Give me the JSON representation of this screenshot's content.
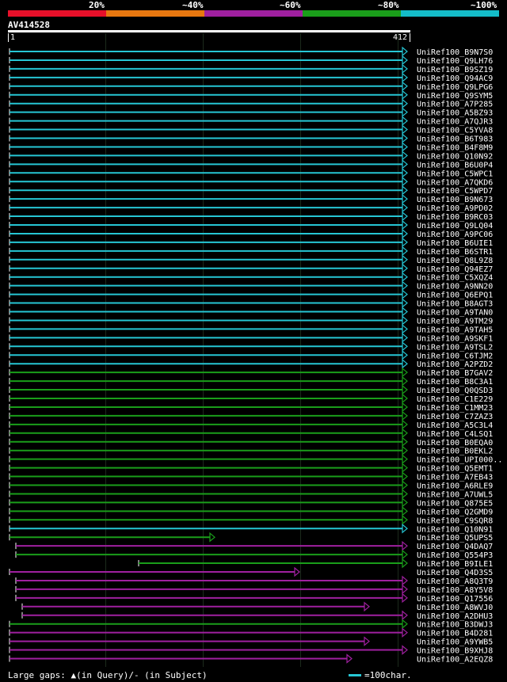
{
  "header": {
    "percent_labels": [
      "20%",
      "~40%",
      "~60%",
      "~80%",
      "~100%"
    ],
    "colors": [
      "#e8102a",
      "#e87810",
      "#a020a0",
      "#1a9e1a",
      "#14bcc8"
    ]
  },
  "query": {
    "name": "AV414528",
    "start": "1",
    "end": "412"
  },
  "hits": [
    {
      "label": "UniRef100_B9N7S0",
      "color": "#26c6d4"
    },
    {
      "label": "UniRef100_Q9LH76",
      "color": "#26c6d4"
    },
    {
      "label": "UniRef100_B9SZ19",
      "color": "#26c6d4"
    },
    {
      "label": "UniRef100_Q94AC9",
      "color": "#26c6d4"
    },
    {
      "label": "UniRef100_Q9LPG6",
      "color": "#26c6d4"
    },
    {
      "label": "UniRef100_Q9SYM5",
      "color": "#26c6d4"
    },
    {
      "label": "UniRef100_A7P285",
      "color": "#26c6d4"
    },
    {
      "label": "UniRef100_A5BZ93",
      "color": "#26c6d4"
    },
    {
      "label": "UniRef100_A7QJR3",
      "color": "#26c6d4"
    },
    {
      "label": "UniRef100_C5YVA8",
      "color": "#26c6d4"
    },
    {
      "label": "UniRef100_B6T983",
      "color": "#26c6d4"
    },
    {
      "label": "UniRef100_B4F8M9",
      "color": "#26c6d4"
    },
    {
      "label": "UniRef100_Q10N92",
      "color": "#26c6d4"
    },
    {
      "label": "UniRef100_B6U0P4",
      "color": "#26c6d4"
    },
    {
      "label": "UniRef100_C5WPC1",
      "color": "#26c6d4"
    },
    {
      "label": "UniRef100_A7QKD6",
      "color": "#26c6d4"
    },
    {
      "label": "UniRef100_C5WPD7",
      "color": "#26c6d4"
    },
    {
      "label": "UniRef100_B9N673",
      "color": "#26c6d4"
    },
    {
      "label": "UniRef100_A9PD02",
      "color": "#26c6d4"
    },
    {
      "label": "UniRef100_B9RC03",
      "color": "#26c6d4"
    },
    {
      "label": "UniRef100_Q9LQ04",
      "color": "#26c6d4"
    },
    {
      "label": "UniRef100_A9PC06",
      "color": "#26c6d4"
    },
    {
      "label": "UniRef100_B6UIE1",
      "color": "#26c6d4"
    },
    {
      "label": "UniRef100_B6STR1",
      "color": "#26c6d4"
    },
    {
      "label": "UniRef100_Q8L9Z8",
      "color": "#26c6d4"
    },
    {
      "label": "UniRef100_Q94EZ7",
      "color": "#26c6d4"
    },
    {
      "label": "UniRef100_C5XQZ4",
      "color": "#26c6d4"
    },
    {
      "label": "UniRef100_A9NN20",
      "color": "#26c6d4"
    },
    {
      "label": "UniRef100_Q6EPQ1",
      "color": "#26c6d4"
    },
    {
      "label": "UniRef100_B8AGT3",
      "color": "#26c6d4"
    },
    {
      "label": "UniRef100_A9TAN0",
      "color": "#26c6d4"
    },
    {
      "label": "UniRef100_A9TM29",
      "color": "#26c6d4"
    },
    {
      "label": "UniRef100_A9TAH5",
      "color": "#26c6d4"
    },
    {
      "label": "UniRef100_A9SKF1",
      "color": "#26c6d4"
    },
    {
      "label": "UniRef100_A9TSL2",
      "color": "#26c6d4"
    },
    {
      "label": "UniRef100_C6TJM2",
      "color": "#26c6d4"
    },
    {
      "label": "UniRef100_A2PZD2",
      "color": "#26c6d4"
    },
    {
      "label": "UniRef100_B7GAV2",
      "color": "#1a9e1a"
    },
    {
      "label": "UniRef100_B8C3A1",
      "color": "#1a9e1a"
    },
    {
      "label": "UniRef100_Q0QSD3",
      "color": "#1a9e1a"
    },
    {
      "label": "UniRef100_C1E229",
      "color": "#1a9e1a"
    },
    {
      "label": "UniRef100_C1MM23",
      "color": "#1a9e1a"
    },
    {
      "label": "UniRef100_C7ZAZ3",
      "color": "#1a9e1a"
    },
    {
      "label": "UniRef100_A5C3L4",
      "color": "#1a9e1a"
    },
    {
      "label": "UniRef100_C4LSQ1",
      "color": "#1a9e1a"
    },
    {
      "label": "UniRef100_B0EQA0",
      "color": "#1a9e1a"
    },
    {
      "label": "UniRef100_B0EKL2",
      "color": "#1a9e1a"
    },
    {
      "label": "UniRef100_UPI000..",
      "color": "#1a9e1a"
    },
    {
      "label": "UniRef100_Q5EMT1",
      "color": "#1a9e1a"
    },
    {
      "label": "UniRef100_A7EB43",
      "color": "#1a9e1a"
    },
    {
      "label": "UniRef100_A6RLE9",
      "color": "#1a9e1a"
    },
    {
      "label": "UniRef100_A7UWL5",
      "color": "#1a9e1a"
    },
    {
      "label": "UniRef100_Q875E5",
      "color": "#1a9e1a"
    },
    {
      "label": "UniRef100_Q2GMD9",
      "color": "#1a9e1a"
    },
    {
      "label": "UniRef100_C9SQR8",
      "color": "#1a9e1a"
    },
    {
      "label": "UniRef100_Q10N91",
      "color": "#26c6d4"
    },
    {
      "label": "UniRef100_Q5UPS5",
      "color": "#1a9e1a"
    },
    {
      "label": "UniRef100_Q4DAQ7",
      "color": "#a020a0"
    },
    {
      "label": "UniRef100_Q554P3",
      "color": "#1a9e1a"
    },
    {
      "label": "UniRef100_B9ILE1",
      "color": "#1a9e1a"
    },
    {
      "label": "UniRef100_Q4D3S5",
      "color": "#a020a0"
    },
    {
      "label": "UniRef100_A8Q3T9",
      "color": "#a020a0"
    },
    {
      "label": "UniRef100_A8Y5V8",
      "color": "#a020a0"
    },
    {
      "label": "UniRef100_Q17556",
      "color": "#a020a0"
    },
    {
      "label": "UniRef100_A8WVJ0",
      "color": "#a020a0"
    },
    {
      "label": "UniRef100_A2DHU3",
      "color": "#a020a0"
    },
    {
      "label": "UniRef100_B3DWJ3",
      "color": "#1a9e1a"
    },
    {
      "label": "UniRef100_B4D281",
      "color": "#a020a0"
    },
    {
      "label": "UniRef100_A9YWB5",
      "color": "#a020a0"
    },
    {
      "label": "UniRef100_B9XHJ8",
      "color": "#a020a0"
    },
    {
      "label": "UniRef100_A2EQZ8",
      "color": "#a020a0"
    }
  ],
  "legend": {
    "gaps_text": "Large gaps: ▲(in Query)/- (in Subject)",
    "scale_text": "=100char."
  }
}
